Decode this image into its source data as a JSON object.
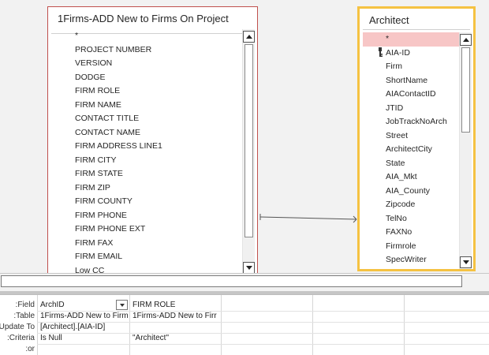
{
  "tables": {
    "left": {
      "title": "1Firms-ADD New to Firms On Project",
      "fields": [
        "*",
        "PROJECT NUMBER",
        "VERSION",
        "DODGE",
        "FIRM ROLE",
        "FIRM NAME",
        "CONTACT TITLE",
        "CONTACT NAME",
        "FIRM ADDRESS LINE1",
        "FIRM CITY",
        "FIRM STATE",
        "FIRM ZIP",
        "FIRM COUNTY",
        "FIRM PHONE",
        "FIRM PHONE EXT",
        "FIRM FAX",
        "FIRM EMAIL",
        "Low CC"
      ]
    },
    "right": {
      "title": "Architect",
      "fields": [
        "*",
        "AIA-ID",
        "Firm",
        "ShortName",
        "AIAContactID",
        "JTID",
        "JobTrackNoArch",
        "Street",
        "ArchitectCity",
        "State",
        "AIA_Mkt",
        "AIA_County",
        "Zipcode",
        "TelNo",
        "FAXNo",
        "Firmrole",
        "SpecWriter"
      ],
      "key_field": "AIA-ID",
      "selected_field": "*",
      "key_icon": "key-icon"
    }
  },
  "colors": {
    "left_border": "#c0504d",
    "right_border": "#f5c242",
    "selected_row": "#f7c6c6"
  },
  "grid": {
    "row_labels": [
      "Field:",
      "Table:",
      "Update To:",
      "Criteria:",
      "or:"
    ],
    "columns": [
      {
        "field": "ArchID",
        "table": "1Firms-ADD New to Firm",
        "update_to": "[Architect].[AIA-ID]",
        "criteria": "Is Null",
        "or": ""
      },
      {
        "field": "FIRM ROLE",
        "table": "1Firms-ADD New to Firr",
        "update_to": "",
        "criteria": "\"Architect\"",
        "or": ""
      },
      {
        "field": "",
        "table": "",
        "update_to": "",
        "criteria": "",
        "or": ""
      },
      {
        "field": "",
        "table": "",
        "update_to": "",
        "criteria": "",
        "or": ""
      },
      {
        "field": "",
        "table": "",
        "update_to": "",
        "criteria": "",
        "or": ""
      }
    ]
  }
}
